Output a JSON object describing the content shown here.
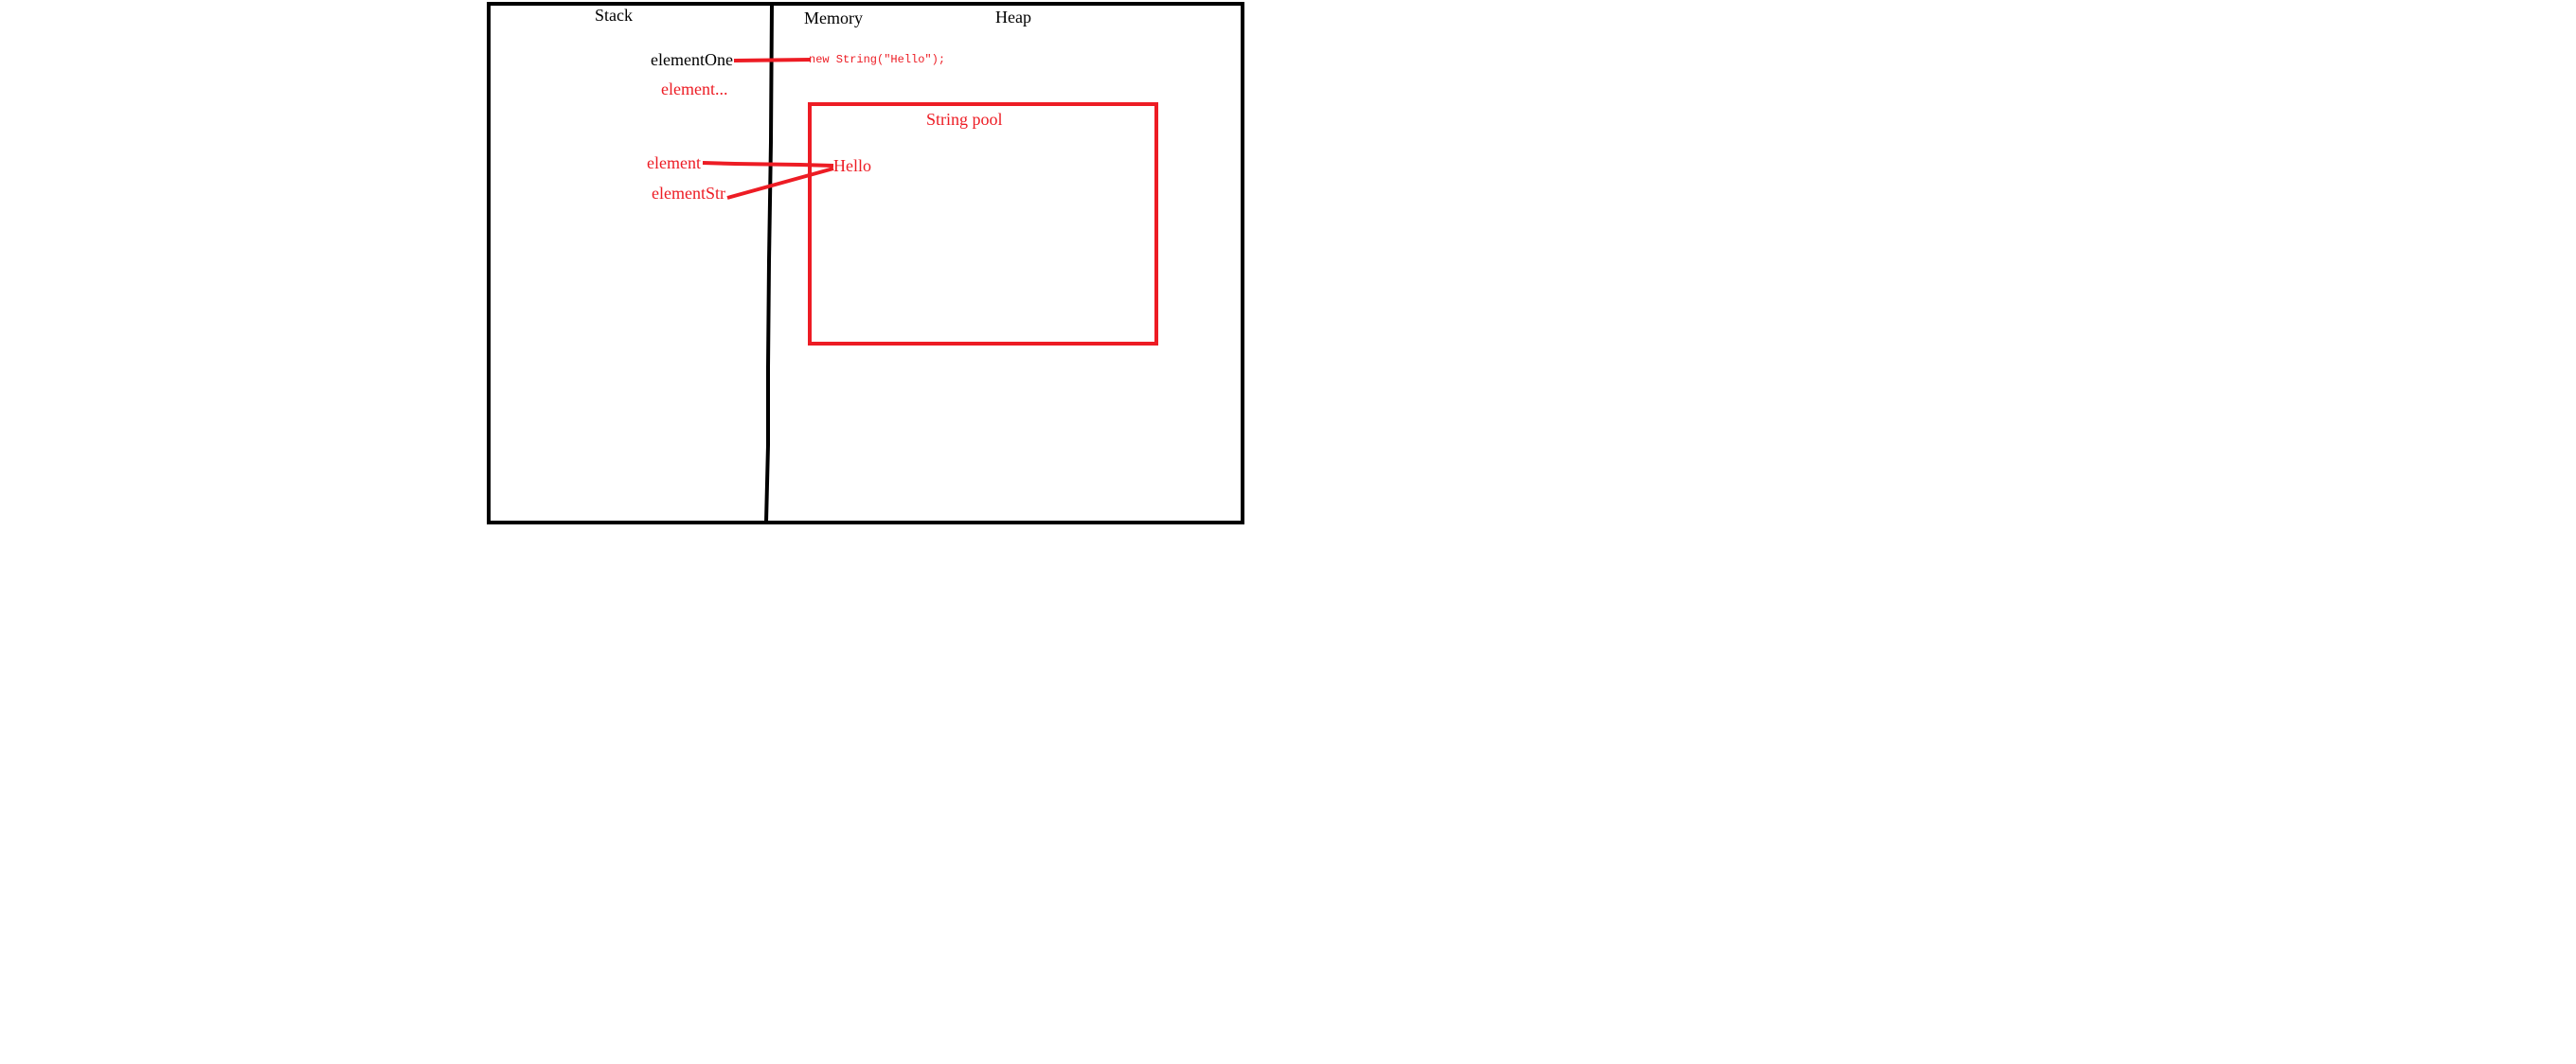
{
  "colors": {
    "ink": "#000000",
    "red": "#ed1c24",
    "background": "#ffffff"
  },
  "memory_diagram": {
    "stack_label": "Stack",
    "memory_label": "Memory",
    "heap_label": "Heap",
    "string_pool_label": "String pool",
    "stack_vars": {
      "element_one": "elementOne",
      "element_ellipsis": "element...",
      "element": "element",
      "element_str": "elementStr"
    },
    "heap_objects": {
      "new_string_code": "new String(\"Hello\");",
      "pool_literal": "Hello"
    }
  }
}
